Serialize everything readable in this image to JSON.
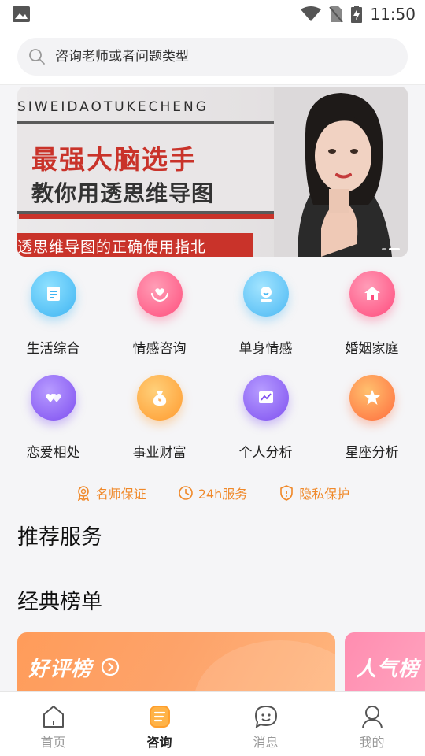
{
  "status_bar": {
    "time": "11:50"
  },
  "search": {
    "placeholder": "咨询老师或者问题类型"
  },
  "banner": {
    "pinyin": "SIWEIDAOTUKECHENG",
    "headline": "最强大脑选手",
    "subhead": "教你用透思维导图",
    "bottom_text": "透思维导图的正确使用指北"
  },
  "categories": [
    {
      "label": "生活综合",
      "icon": "scroll-icon",
      "color": "#4fc6f5"
    },
    {
      "label": "情感咨询",
      "icon": "heart-hands-icon",
      "color": "#ff5f8a"
    },
    {
      "label": "单身情感",
      "icon": "person-icon",
      "color": "#54c2f7"
    },
    {
      "label": "婚姻家庭",
      "icon": "house-icon",
      "color": "#ff5b87"
    },
    {
      "label": "恋爱相处",
      "icon": "two-hearts-icon",
      "color": "#8a5cf2"
    },
    {
      "label": "事业财富",
      "icon": "money-bag-icon",
      "color": "#ffa23a"
    },
    {
      "label": "个人分析",
      "icon": "chart-icon",
      "color": "#8d5df2"
    },
    {
      "label": "星座分析",
      "icon": "star-icon",
      "color": "#ff7d45"
    }
  ],
  "guarantees": [
    {
      "label": "名师保证",
      "icon": "badge-icon"
    },
    {
      "label": "24h服务",
      "icon": "clock-icon"
    },
    {
      "label": "隐私保护",
      "icon": "shield-icon"
    }
  ],
  "sections": {
    "recommended": "推荐服务",
    "rankings": "经典榜单"
  },
  "rankings": [
    {
      "label": "好评榜"
    },
    {
      "label": "人气榜"
    }
  ],
  "nav": [
    {
      "label": "首页",
      "icon": "home-icon",
      "active": false
    },
    {
      "label": "咨询",
      "icon": "consult-icon",
      "active": true
    },
    {
      "label": "消息",
      "icon": "message-icon",
      "active": false
    },
    {
      "label": "我的",
      "icon": "profile-icon",
      "active": false
    }
  ],
  "colors": {
    "accent": "#f0892a",
    "nav_active": "#ff9f2d"
  }
}
